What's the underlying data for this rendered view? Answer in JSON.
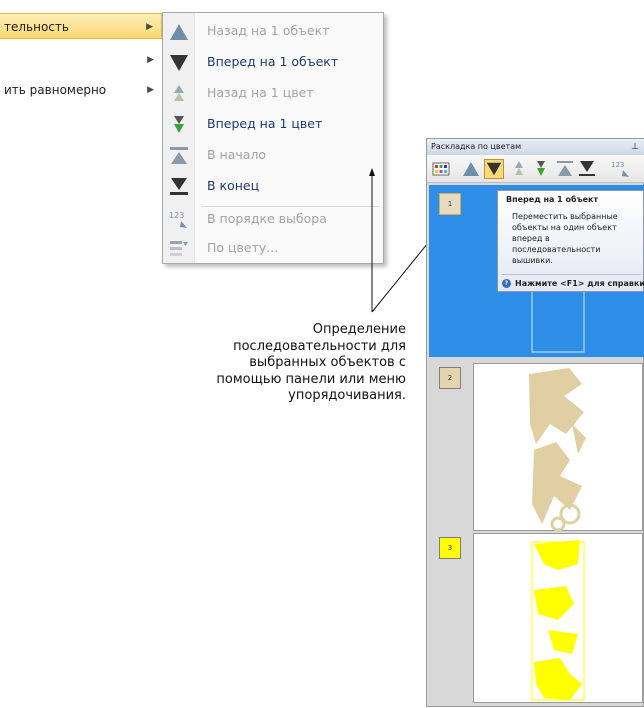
{
  "parent_menu": {
    "items": [
      {
        "label": "тельность",
        "has_submenu": true,
        "highlighted": true
      },
      {
        "label": "",
        "has_submenu": true,
        "highlighted": false
      },
      {
        "label": "ить равномерно",
        "has_submenu": true,
        "highlighted": false
      }
    ]
  },
  "submenu": {
    "items": [
      {
        "label": "Назад на 1 объект",
        "icon": "triangle-up-icon",
        "enabled": false
      },
      {
        "label": "Вперед на 1 объект",
        "icon": "triangle-down-icon",
        "enabled": true
      },
      {
        "label": "Назад на 1 цвет",
        "icon": "color-up-icon",
        "enabled": false
      },
      {
        "label": "Вперед на 1 цвет",
        "icon": "color-down-icon",
        "enabled": true
      },
      {
        "label": "В начало",
        "icon": "to-start-icon",
        "enabled": false
      },
      {
        "label": "В конец",
        "icon": "to-end-icon",
        "enabled": true
      },
      {
        "label": "В порядке выбора",
        "icon": "selection-order-icon",
        "enabled": false
      },
      {
        "label": "По цвету...",
        "icon": "by-color-icon",
        "enabled": false
      }
    ]
  },
  "annotation": {
    "lines": [
      "Определение",
      "последовательности для",
      "выбранных объектов с",
      "помощью панели или меню",
      "упорядочивания."
    ]
  },
  "docker": {
    "title": "Раскладка по цветам",
    "pin_icon": "pin-icon",
    "rows": [
      {
        "number": "1",
        "swatch_color": "#e8dcc0",
        "selected": true
      },
      {
        "number": "2",
        "swatch_color": "#e3d4ad",
        "selected": false
      },
      {
        "number": "3",
        "swatch_color": "#ffff00",
        "selected": false
      }
    ]
  },
  "tooltip": {
    "title": "Вперед на 1 объект",
    "description": "Переместить выбранные объекты на один объект вперед в последовательности вышивки.",
    "help": "Нажмите <F1> для справки"
  },
  "colors": {
    "accent_orange": "#fbd870",
    "selection_blue": "#2e8de6",
    "enabled_text": "#1f3a73",
    "disabled_text": "#a3a3a3",
    "stitch_tan": "#e0cfa3",
    "stitch_yellow": "#ffff00"
  }
}
